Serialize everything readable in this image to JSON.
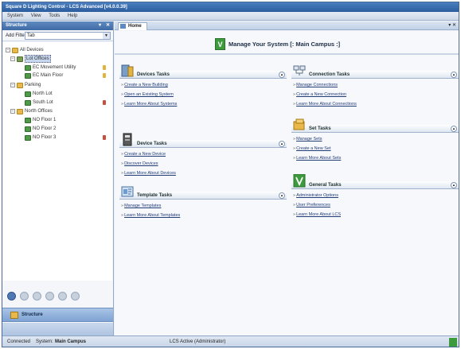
{
  "window": {
    "title": "Square D Lighting Control - LCS Advanced [v4.0.0.39]"
  },
  "menu": [
    "System",
    "View",
    "Tools",
    "Help"
  ],
  "left_pane": {
    "title": "Structure",
    "filter_label": "Add Filter by:",
    "filter_value": "Tab",
    "tree": [
      {
        "label": "All Devices",
        "icon": "folder-icon"
      },
      {
        "label": "Lot Offices",
        "icon": "building-icon"
      },
      {
        "label": "EC Movement Utility",
        "icon": "device-icon"
      },
      {
        "label": "EC Main Floor",
        "icon": "device-icon"
      },
      {
        "label": "Parking",
        "icon": "folder-icon"
      },
      {
        "label": "North Lot",
        "icon": "device-icon"
      },
      {
        "label": "South Lot",
        "icon": "device-icon"
      },
      {
        "label": "North Offices",
        "icon": "folder-icon"
      },
      {
        "label": "NO Floor 1",
        "icon": "device-icon"
      },
      {
        "label": "NO Floor 2",
        "icon": "device-icon"
      },
      {
        "label": "NO Floor 3",
        "icon": "device-icon"
      }
    ],
    "nav_button": "Structure"
  },
  "tab": {
    "label": "Home"
  },
  "banner": "Manage Your System [: Main Campus :]",
  "cards": {
    "devices": {
      "title": "Devices Tasks",
      "icon": "cabinet-icon",
      "links": [
        "Create a New Building",
        "Open an Existing System",
        "Learn More About Systems"
      ]
    },
    "device": {
      "title": "Device Tasks",
      "icon": "device-panel-icon",
      "links": [
        "Create a New Device",
        "Discover Devices",
        "Learn More About Devices"
      ]
    },
    "template": {
      "title": "Template Tasks",
      "icon": "template-icon",
      "links": [
        "Manage Templates",
        "Learn More About Templates"
      ]
    },
    "connection": {
      "title": "Connection Tasks",
      "icon": "network-icon",
      "links": [
        "Manage Connections",
        "Create a New Connection",
        "Learn More About Connections"
      ]
    },
    "set": {
      "title": "Set Tasks",
      "icon": "folder-set-icon",
      "links": [
        "Manage Sets",
        "Create a New Set",
        "Learn More About Sets"
      ]
    },
    "general": {
      "title": "General Tasks",
      "icon": "v-logo-icon",
      "links": [
        "Administrator Options",
        "User Preferences",
        "Learn More About LCS"
      ]
    }
  },
  "status": {
    "connection": "Connected",
    "system_label": "System:",
    "system": "Main Campus",
    "mode": "LCS Active (Administrator)"
  },
  "colors": {
    "accent": "#3e6aa5",
    "brand_green": "#3d9a3d",
    "link": "#223c78"
  }
}
